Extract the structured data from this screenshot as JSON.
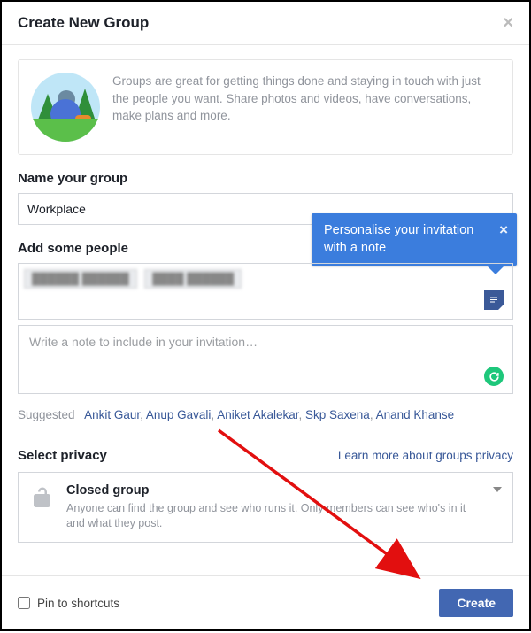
{
  "header": {
    "title": "Create New Group"
  },
  "intro": {
    "text": "Groups are great for getting things done and staying in touch with just the people you want. Share photos and videos, have conversations, make plans and more."
  },
  "nameSection": {
    "label": "Name your group",
    "value": "Workplace"
  },
  "peopleSection": {
    "label": "Add some people",
    "chips": [
      "██████ ██████",
      "████ ██████"
    ],
    "tooltip": "Personalise your invitation with a note"
  },
  "note": {
    "placeholder": "Write a note to include in your invitation…"
  },
  "suggested": {
    "label": "Suggested",
    "names": [
      "Ankit Gaur",
      "Anup Gavali",
      "Aniket Akalekar",
      "Skp Saxena",
      "Anand Khanse"
    ]
  },
  "privacy": {
    "label": "Select privacy",
    "learn": "Learn more about groups privacy",
    "option": {
      "title": "Closed group",
      "desc": "Anyone can find the group and see who runs it. Only members can see who's in it and what they post."
    }
  },
  "footer": {
    "pin": "Pin to shortcuts",
    "create": "Create"
  }
}
